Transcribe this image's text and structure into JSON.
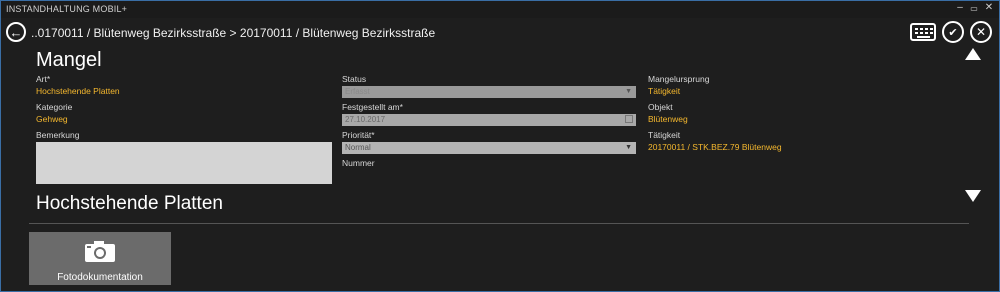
{
  "app": {
    "title": "INSTANDHALTUNG MOBIL+"
  },
  "window_controls": {
    "minimize": "–",
    "restore": "▭",
    "close": "✕"
  },
  "header": {
    "breadcrumb": "..0170011 / Blütenweg Bezirksstraße > 20170011 / Blütenweg Bezirksstraße",
    "check_symbol": "✔",
    "cancel_symbol": "✕",
    "back_symbol": "←"
  },
  "mangel": {
    "heading": "Mangel",
    "art_label": "Art*",
    "art_value": "Hochstehende Platten",
    "kategorie_label": "Kategorie",
    "kategorie_value": "Gehweg",
    "bemerkung_label": "Bemerkung",
    "status_label": "Status",
    "status_value": "Erfasst",
    "festgestellt_label": "Festgestellt am*",
    "festgestellt_value": "27.10.2017",
    "prioritaet_label": "Priorität*",
    "prioritaet_value": "Normal",
    "nummer_label": "Nummer",
    "mangelursprung_label": "Mangelursprung",
    "mangelursprung_value": "Tätigkeit",
    "objekt_label": "Objekt",
    "objekt_value": "Blütenweg",
    "taetigkeit_label": "Tätigkeit",
    "taetigkeit_value": "20170011 / STK.BEZ.79 Blütenweg"
  },
  "section2": {
    "heading": "Hochstehende Platten"
  },
  "tiles": [
    {
      "label": "Fotodokumentation",
      "icon": "camera-icon"
    }
  ],
  "colors": {
    "accent": "#f5b82e",
    "background": "#1e1e1e",
    "tile": "#6b6b6b"
  }
}
